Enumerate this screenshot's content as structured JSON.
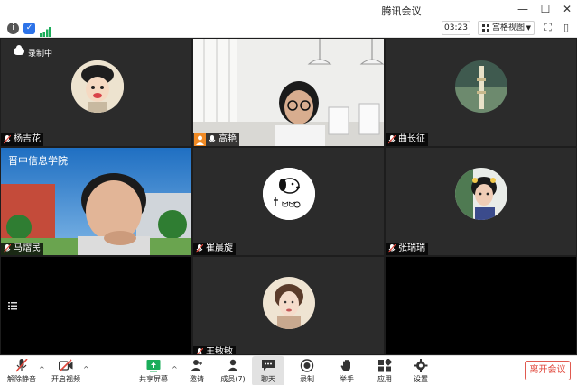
{
  "window": {
    "title": "腾讯会议"
  },
  "topbar": {
    "timer": "03:23",
    "view_label": "宫格视图"
  },
  "recording": {
    "label": "录制中"
  },
  "participants": [
    {
      "name": "杨吉花"
    },
    {
      "name": "高艳"
    },
    {
      "name": "曲长征"
    },
    {
      "name": "马熠民"
    },
    {
      "name": "崔晨旋"
    },
    {
      "name": "张瑞瑞"
    },
    {
      "name": ""
    },
    {
      "name": "王敏敏"
    },
    {
      "name": ""
    }
  ],
  "toolbar": {
    "unmute": "解除静音",
    "start_video": "开启视频",
    "share_screen": "共享屏幕",
    "invite": "邀请",
    "members": "成员(7)",
    "chat": "聊天",
    "record": "录制",
    "raise_hand": "举手",
    "apps": "应用",
    "settings": "设置",
    "leave": "离开会议"
  },
  "colors": {
    "accent_green": "#1aad5a",
    "leave_red": "#e0463a",
    "tile_bg": "#2b2b2b"
  }
}
